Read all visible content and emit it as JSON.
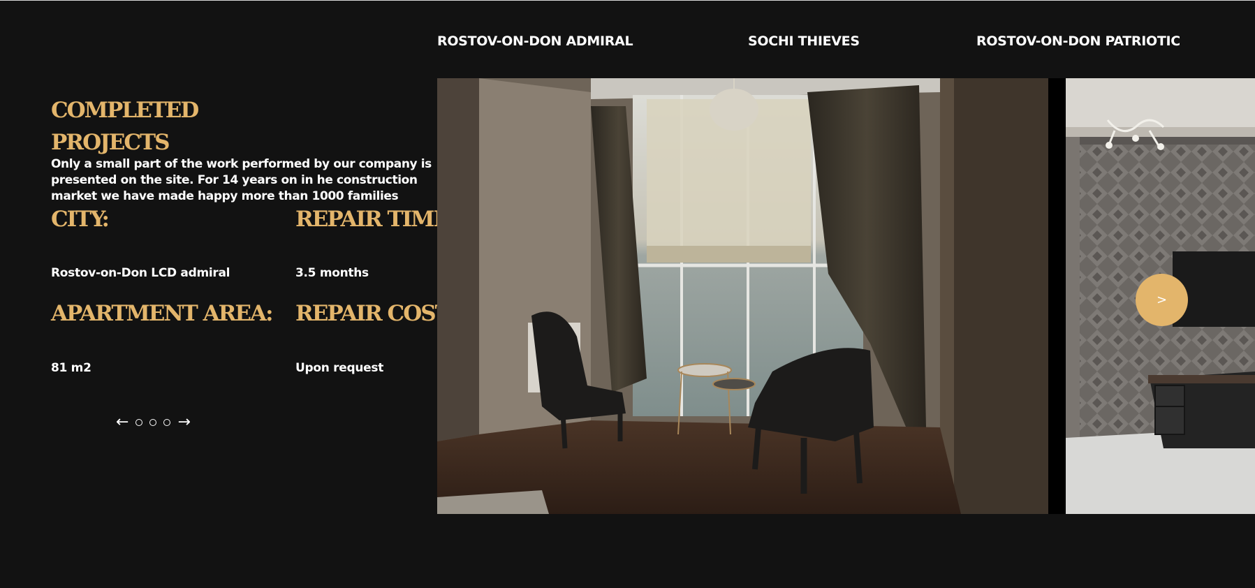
{
  "tabs": [
    {
      "label": "ROSTOV-ON-DON ADMIRAL"
    },
    {
      "label": "SOCHI THIEVES"
    },
    {
      "label": "ROSTOV-ON-DON PATRIOTIC"
    }
  ],
  "intro": {
    "title": "COMPLETED PROJECTS",
    "description": "Only a small part of the work performed by our company is presented on the site. For 14 years on in he construction market we have made happy more than 1000 families"
  },
  "details": {
    "city_label": "CITY:",
    "city_value": "Rostov-on-Don LCD admiral",
    "time_label": "REPAIR TIME:",
    "time_value": "3.5 months",
    "area_label": "APARTMENT AREA:",
    "area_value": "81 m2",
    "cost_label": "REPAIR COST:",
    "cost_value": "Upon request"
  },
  "pager": {
    "prev": "←",
    "next": "→",
    "dots": 3
  },
  "slider": {
    "next_label": ">"
  },
  "colors": {
    "background": "#121212",
    "accent": "#e3b56b",
    "text": "#ffffff"
  },
  "icons": [
    "arrow-left-icon",
    "arrow-right-icon",
    "chevron-right-icon"
  ]
}
